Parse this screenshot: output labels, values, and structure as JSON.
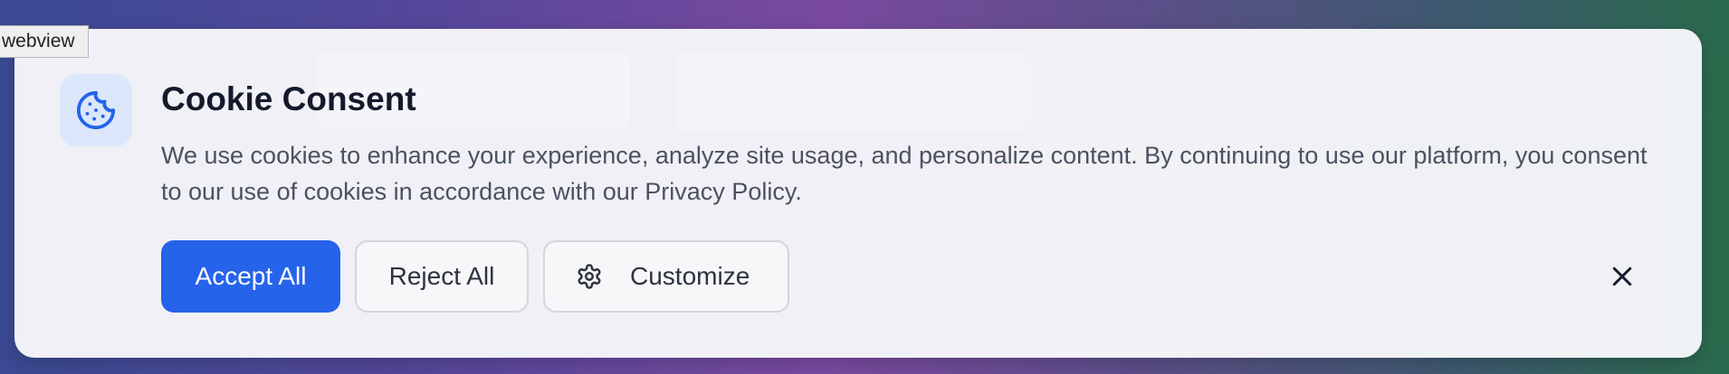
{
  "tooltip": {
    "label": "webview"
  },
  "cookie_banner": {
    "icon": "cookie-icon",
    "title": "Cookie Consent",
    "message": "We use cookies to enhance your experience, analyze site usage, and personalize content. By continuing to use our platform, you consent to our use of cookies in accordance with our Privacy Policy.",
    "buttons": {
      "accept_label": "Accept All",
      "reject_label": "Reject All",
      "customize_label": "Customize",
      "customize_icon": "gear-icon"
    },
    "close_icon": "close-icon"
  },
  "colors": {
    "accent": "#2563eb",
    "icon_bg": "#dce7fb",
    "title_text": "#141a2b",
    "body_text": "#4a5260"
  }
}
